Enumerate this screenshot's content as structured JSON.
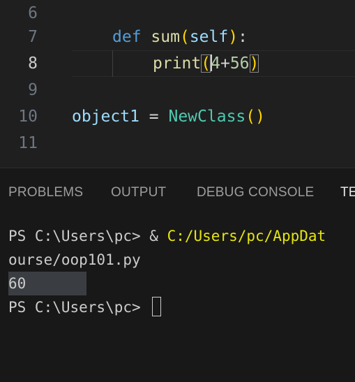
{
  "editor": {
    "lines": [
      {
        "number": "6"
      },
      {
        "number": "7",
        "tokens": {
          "kw": "def",
          "fn": "sum",
          "open": "(",
          "param": "self",
          "close": ")",
          "colon": ":"
        }
      },
      {
        "number": "8",
        "tokens": {
          "fn": "print",
          "open": "(",
          "arg_a": "4",
          "op": "+",
          "arg_b": "56",
          "close": ")"
        }
      },
      {
        "number": "9"
      },
      {
        "number": "10",
        "tokens": {
          "var": "object1",
          "eq": " = ",
          "cls": "NewClass",
          "open": "(",
          "close": ")"
        }
      },
      {
        "number": "11"
      }
    ]
  },
  "panel": {
    "tabs": [
      "PROBLEMS",
      "OUTPUT",
      "DEBUG CONSOLE",
      "TE"
    ],
    "active_tab_index": 3
  },
  "terminal": {
    "line1_prompt": "PS C:\\Users\\pc> ",
    "line1_amp": "& ",
    "line1_path": "C:/Users/pc/AppDat",
    "line2": "ourse/oop101.py",
    "line3_output": "60",
    "line4_prompt": "PS C:\\Users\\pc> "
  },
  "colors": {
    "editor_bg": "#1f1f1f",
    "panel_bg": "#181818",
    "keyword": "#569cd6",
    "function": "#dcdcaa",
    "variable": "#9cdcfe",
    "class": "#4ec9b0",
    "number": "#b5cea8",
    "terminal_path": "#e5e510"
  }
}
